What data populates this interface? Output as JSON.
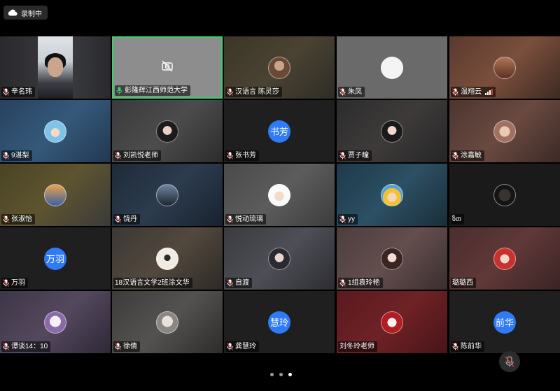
{
  "recording": {
    "label": "录制中",
    "icon": "cloud-icon"
  },
  "participants": [
    {
      "name": "辛名玮",
      "mic": "muted",
      "kind": "video"
    },
    {
      "name": "彭隆辉江西师范大学",
      "mic": "speaking",
      "kind": "camera-off",
      "active": true
    },
    {
      "name": "汉语言 陈灵莎",
      "mic": "muted",
      "kind": "avatar"
    },
    {
      "name": "朱凤",
      "mic": "muted",
      "kind": "avatar"
    },
    {
      "name": "温翔云",
      "mic": "muted",
      "kind": "avatar",
      "signal": true
    },
    {
      "name": "9湛梨",
      "mic": "muted",
      "kind": "avatar"
    },
    {
      "name": "刘凯悦老师",
      "mic": "muted",
      "kind": "avatar"
    },
    {
      "name": "张书芳",
      "mic": "muted",
      "kind": "text-avatar",
      "avatar_text": "书芳"
    },
    {
      "name": "贾子瞳",
      "mic": "muted",
      "kind": "avatar"
    },
    {
      "name": "涂嘉敏",
      "mic": "muted",
      "kind": "avatar"
    },
    {
      "name": "张淑怡",
      "mic": "muted",
      "kind": "avatar"
    },
    {
      "name": "饶丹",
      "mic": "muted",
      "kind": "avatar"
    },
    {
      "name": "悦动琉璃",
      "mic": "muted",
      "kind": "avatar"
    },
    {
      "name": "yy",
      "mic": "muted",
      "kind": "avatar"
    },
    {
      "name": "ზთ",
      "mic": "none",
      "kind": "avatar"
    },
    {
      "name": "万羽",
      "mic": "muted",
      "kind": "text-avatar",
      "avatar_text": "万羽"
    },
    {
      "name": "18汉语言文学2班涂文华",
      "mic": "none",
      "kind": "avatar"
    },
    {
      "name": "自渡",
      "mic": "muted",
      "kind": "avatar"
    },
    {
      "name": "1组袁玲艳",
      "mic": "muted",
      "kind": "avatar"
    },
    {
      "name": "璐璐西",
      "mic": "none",
      "kind": "avatar"
    },
    {
      "name": "谭谈14：10",
      "mic": "muted",
      "kind": "avatar"
    },
    {
      "name": "徐倩",
      "mic": "muted",
      "kind": "avatar"
    },
    {
      "name": "龚慧玲",
      "mic": "muted",
      "kind": "text-avatar",
      "avatar_text": "慧玲"
    },
    {
      "name": "刘冬玲老师",
      "mic": "none",
      "kind": "avatar"
    },
    {
      "name": "陈前华",
      "mic": "muted",
      "kind": "text-avatar",
      "avatar_text": "前华"
    }
  ],
  "pager": {
    "pages": 3,
    "current": 3
  },
  "colors": {
    "active_border": "#3bd16f",
    "text_avatar": "#2f7bf5",
    "mic_muted": "#e0383a",
    "mic_speaking": "#3bd16f"
  }
}
